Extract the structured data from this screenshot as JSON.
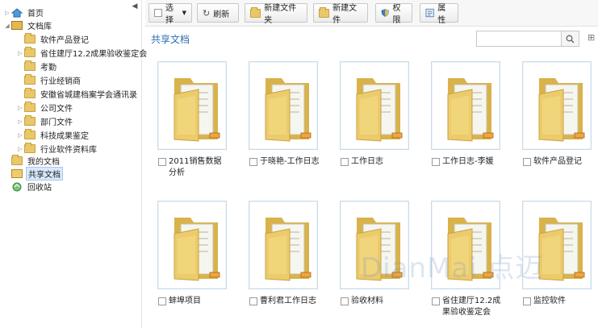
{
  "sidebar": {
    "collapse_icon": "chevron-left-icon",
    "items": [
      {
        "label": "首页",
        "icon": "home-icon"
      },
      {
        "label": "文档库",
        "icon": "library-icon"
      },
      {
        "label": "软件产品登记",
        "icon": "folder-icon"
      },
      {
        "label": "省住建厅12.2成果验收鉴定会",
        "icon": "folder-icon"
      },
      {
        "label": "考勤",
        "icon": "folder-icon"
      },
      {
        "label": "行业经销商",
        "icon": "folder-icon"
      },
      {
        "label": "安徽省城建档案学会通讯录",
        "icon": "folder-icon"
      },
      {
        "label": "公司文件",
        "icon": "folder-icon"
      },
      {
        "label": "部门文件",
        "icon": "folder-icon"
      },
      {
        "label": "科技成果鉴定",
        "icon": "folder-icon"
      },
      {
        "label": "行业软件资料库",
        "icon": "folder-icon"
      },
      {
        "label": "我的文档",
        "icon": "my-docs-icon"
      },
      {
        "label": "共享文档",
        "icon": "shared-docs-icon"
      },
      {
        "label": "回收站",
        "icon": "recycle-icon"
      }
    ]
  },
  "toolbar": {
    "select_label": "选择",
    "refresh_label": "刷新",
    "new_folder_label": "新建文件夹",
    "new_file_label": "新建文件",
    "permission_label": "权限",
    "properties_label": "属性"
  },
  "main": {
    "title": "共享文档",
    "search_placeholder": "",
    "files": [
      {
        "name": "2011销售数据分析"
      },
      {
        "name": "于晓艳-工作日志"
      },
      {
        "name": "工作日志"
      },
      {
        "name": "工作日志-李媛"
      },
      {
        "name": "软件产品登记"
      },
      {
        "name": "蚌埠项目"
      },
      {
        "name": "曹利君工作日志"
      },
      {
        "name": "验收材料"
      },
      {
        "name": "省住建厅12.2成果验收鉴定会"
      },
      {
        "name": "监控软件"
      }
    ]
  },
  "watermark": "DianMai 点迈",
  "colors": {
    "accent": "#2d6fb6",
    "folder": "#e9c869",
    "selected": "#d8e8fb"
  }
}
